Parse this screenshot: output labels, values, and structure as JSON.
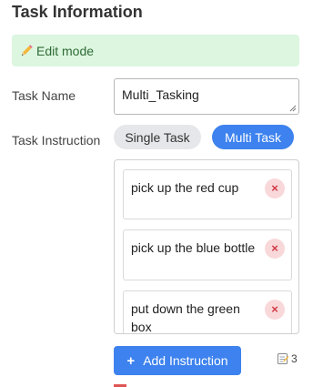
{
  "panel": {
    "title": "Task Information",
    "edit_banner": "Edit mode",
    "edit_icon": "pencil-icon"
  },
  "task_name": {
    "label": "Task Name",
    "value": "Multi_Tasking"
  },
  "task_instruction": {
    "label": "Task Instruction",
    "modes": [
      {
        "label": "Single Task",
        "selected": false
      },
      {
        "label": "Multi Task",
        "selected": true
      }
    ],
    "items": [
      {
        "text": "pick up the red cup"
      },
      {
        "text": "pick up the blue bottle"
      },
      {
        "text": "put down the green box"
      }
    ],
    "remove_glyph": "×"
  },
  "footer": {
    "add_label": "Add Instruction",
    "add_icon": "plus-icon",
    "count_icon": "memo-icon",
    "count": "3"
  },
  "colors": {
    "accent": "#3d82ee",
    "banner_bg": "#dcf6e0",
    "banner_text": "#2f6b34",
    "remove_bg": "#f9d8da",
    "remove_fg": "#d13a46"
  }
}
